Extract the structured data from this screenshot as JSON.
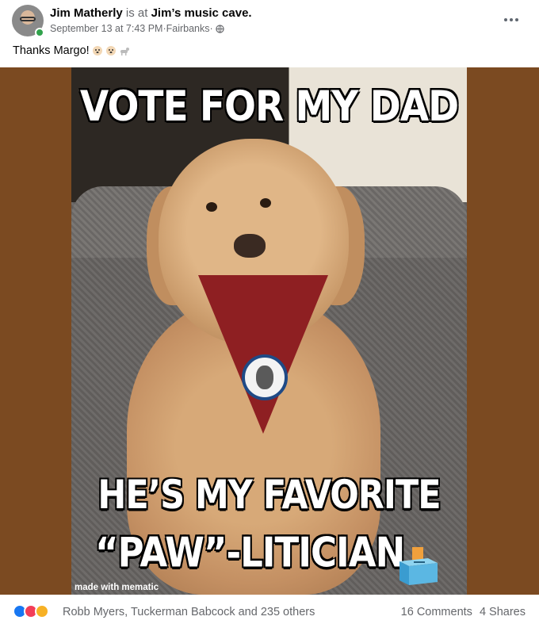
{
  "post": {
    "author": "Jim Matherly",
    "status_mid": " is at ",
    "location": "Jim’s music cave.",
    "timestamp": "September 13 at 7:43 PM",
    "place": "Fairbanks",
    "separator": " · ",
    "privacy_icon": "globe-icon",
    "caption": "Thanks Margo!",
    "caption_emojis": [
      "dog-face-emoji",
      "dog-face-emoji",
      "dog-emoji"
    ]
  },
  "image": {
    "top_text": "VOTE FOR MY DAD",
    "bottom_line1": "HE’S MY FAVORITE",
    "bottom_line2": "“PAW”-LITICIAN",
    "watermark": "made with mematic",
    "ballot_icon": "ballot-box-icon"
  },
  "footer": {
    "reaction_icons": [
      "like-icon",
      "love-icon",
      "haha-icon"
    ],
    "reactors": "Robb Myers, Tuckerman Babcock and 235 others",
    "comments": "16 Comments",
    "shares": "4 Shares"
  },
  "colors": {
    "frame_brown": "#7b4a21",
    "online_green": "#31a24c",
    "like_blue": "#1877f2",
    "love_red": "#f33e58",
    "haha_yellow": "#f7b125",
    "meta_gray": "#65676b"
  }
}
